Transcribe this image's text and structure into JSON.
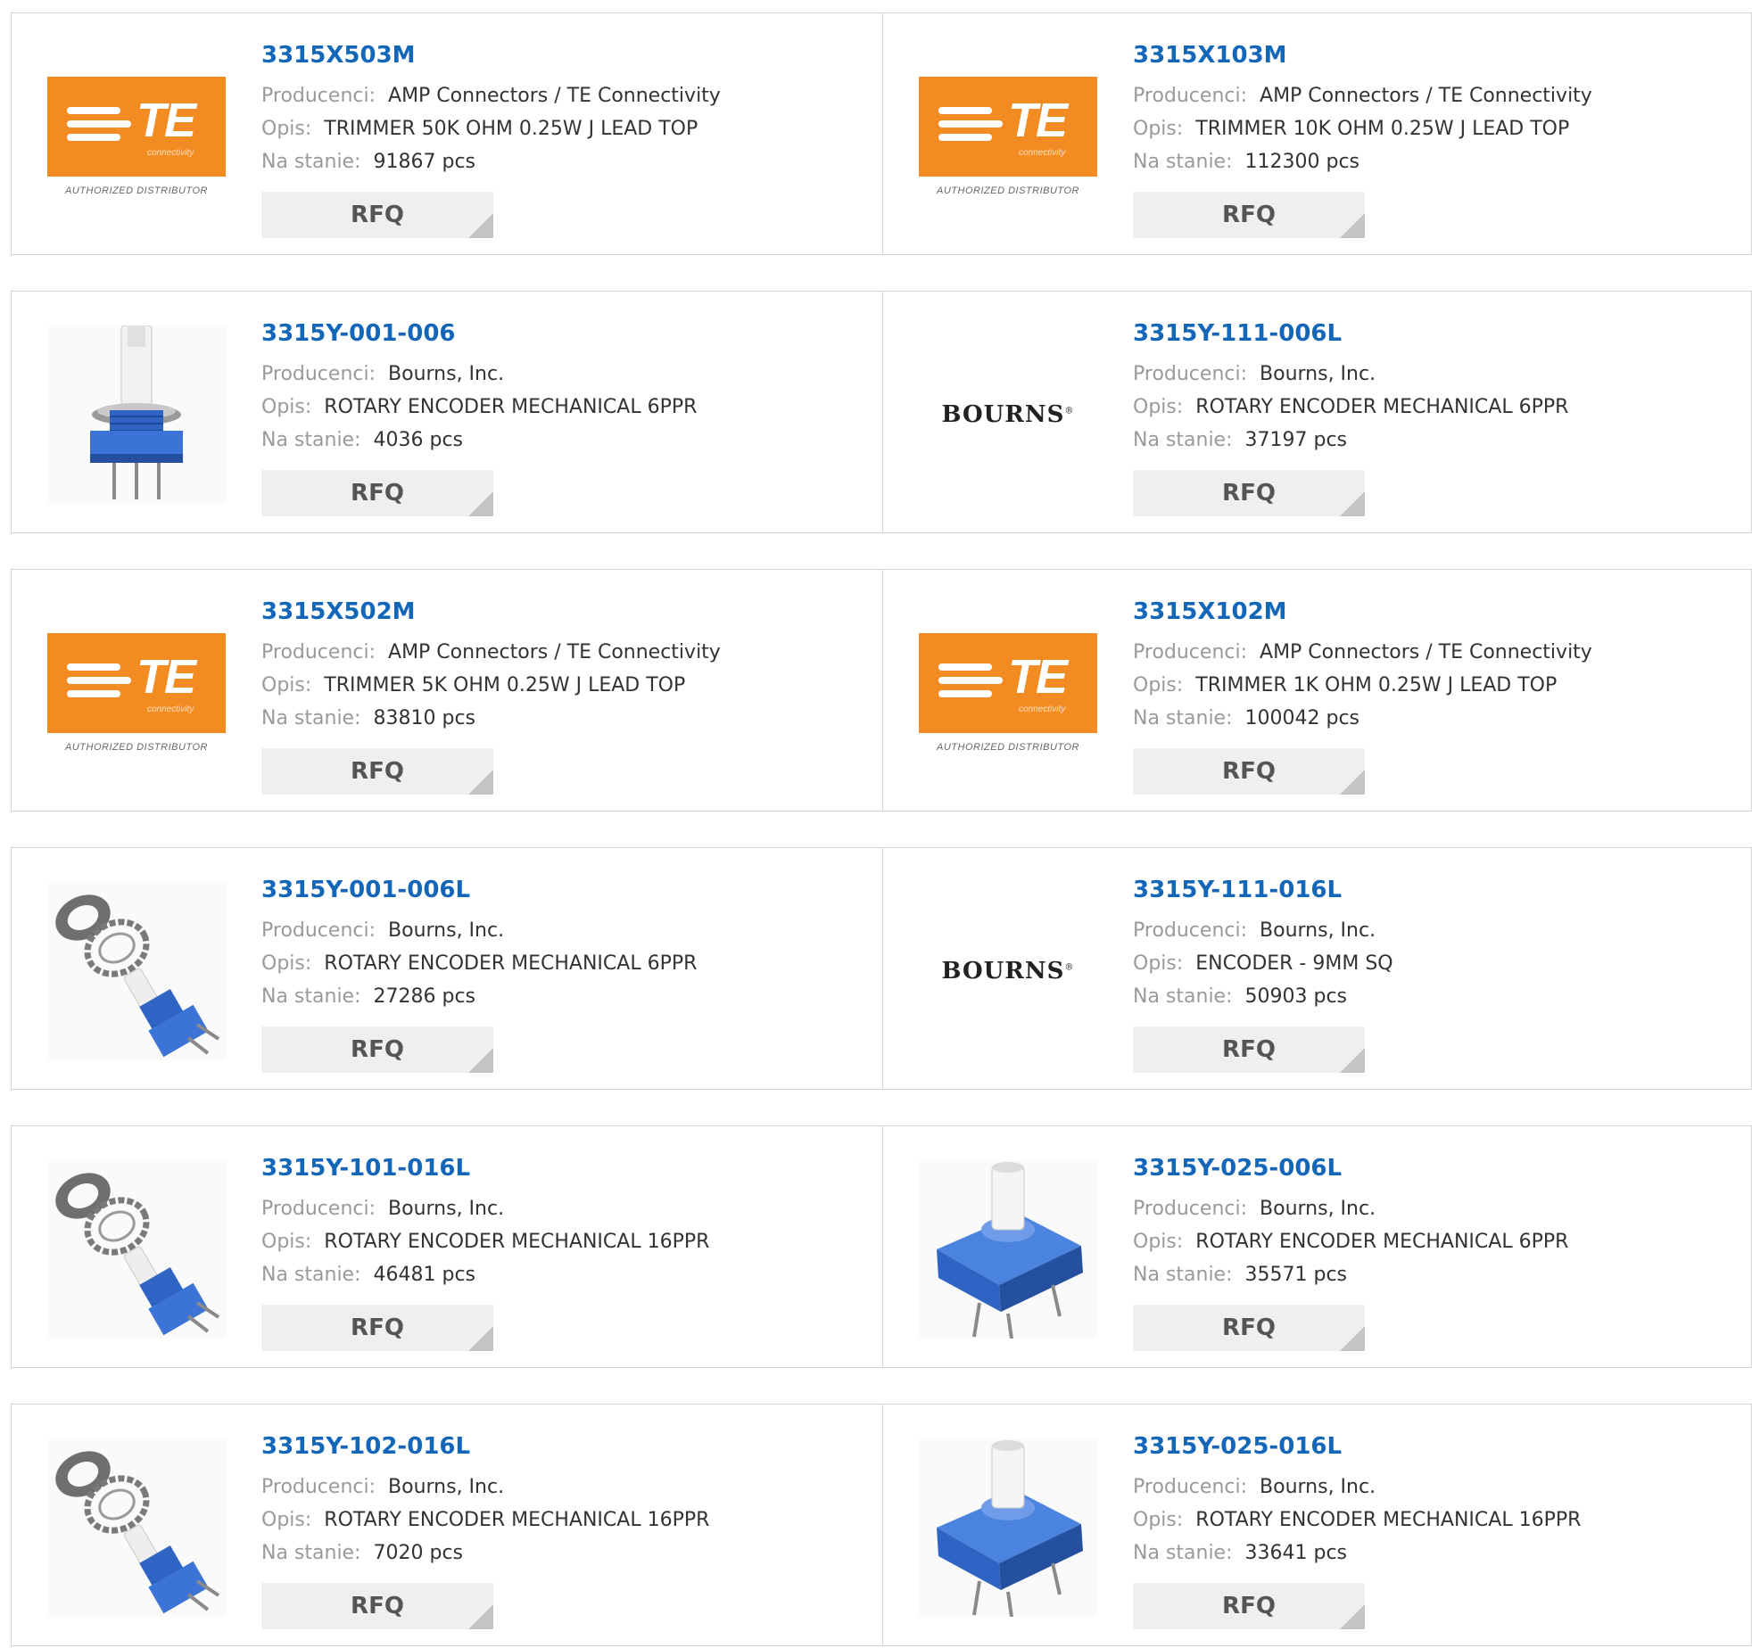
{
  "labels": {
    "manufacturer": "Producenci:",
    "description": "Opis:",
    "stock": "Na stanie:",
    "rfq": "RFQ",
    "stock_unit": "pcs"
  },
  "logos": {
    "te_brand": "TE",
    "te_sub": "connectivity",
    "te_authorized": "AUTHORIZED DISTRIBUTOR",
    "bourns_brand": "BOURNS",
    "bourns_mark": "®",
    "te_color": "#f28c22"
  },
  "colors": {
    "part_link": "#1467b8",
    "label_gray": "#9a9a9a",
    "button_bg": "#efefef",
    "component_blue": "#2f63c4"
  },
  "products": [
    {
      "part": "3315X503M",
      "mfr": "AMP Connectors / TE Connectivity",
      "desc": "TRIMMER 50K OHM 0.25W J LEAD TOP",
      "stock": "91867 pcs",
      "image": "te-logo"
    },
    {
      "part": "3315X103M",
      "mfr": "AMP Connectors / TE Connectivity",
      "desc": "TRIMMER 10K OHM 0.25W J LEAD TOP",
      "stock": "112300 pcs",
      "image": "te-logo"
    },
    {
      "part": "3315Y-001-006",
      "mfr": "Bourns, Inc.",
      "desc": "ROTARY ENCODER MECHANICAL 6PPR",
      "stock": "4036 pcs",
      "image": "encoder-upright-photo"
    },
    {
      "part": "3315Y-111-006L",
      "mfr": "Bourns, Inc.",
      "desc": "ROTARY ENCODER MECHANICAL 6PPR",
      "stock": "37197 pcs",
      "image": "bourns-logo"
    },
    {
      "part": "3315X502M",
      "mfr": "AMP Connectors / TE Connectivity",
      "desc": "TRIMMER 5K OHM 0.25W J LEAD TOP",
      "stock": "83810 pcs",
      "image": "te-logo"
    },
    {
      "part": "3315X102M",
      "mfr": "AMP Connectors / TE Connectivity",
      "desc": "TRIMMER 1K OHM 0.25W J LEAD TOP",
      "stock": "100042 pcs",
      "image": "te-logo"
    },
    {
      "part": "3315Y-001-006L",
      "mfr": "Bourns, Inc.",
      "desc": "ROTARY ENCODER MECHANICAL 6PPR",
      "stock": "27286 pcs",
      "image": "encoder-kit-photo"
    },
    {
      "part": "3315Y-111-016L",
      "mfr": "Bourns, Inc.",
      "desc": "ENCODER - 9MM SQ",
      "stock": "50903 pcs",
      "image": "bourns-logo"
    },
    {
      "part": "3315Y-101-016L",
      "mfr": "Bourns, Inc.",
      "desc": "ROTARY ENCODER MECHANICAL 16PPR",
      "stock": "46481 pcs",
      "image": "encoder-kit-photo"
    },
    {
      "part": "3315Y-025-006L",
      "mfr": "Bourns, Inc.",
      "desc": "ROTARY ENCODER MECHANICAL 6PPR",
      "stock": "35571 pcs",
      "image": "encoder-cube-photo"
    },
    {
      "part": "3315Y-102-016L",
      "mfr": "Bourns, Inc.",
      "desc": "ROTARY ENCODER MECHANICAL 16PPR",
      "stock": "7020 pcs",
      "image": "encoder-kit-photo"
    },
    {
      "part": "3315Y-025-016L",
      "mfr": "Bourns, Inc.",
      "desc": "ROTARY ENCODER MECHANICAL 16PPR",
      "stock": "33641 pcs",
      "image": "encoder-cube-photo"
    }
  ]
}
